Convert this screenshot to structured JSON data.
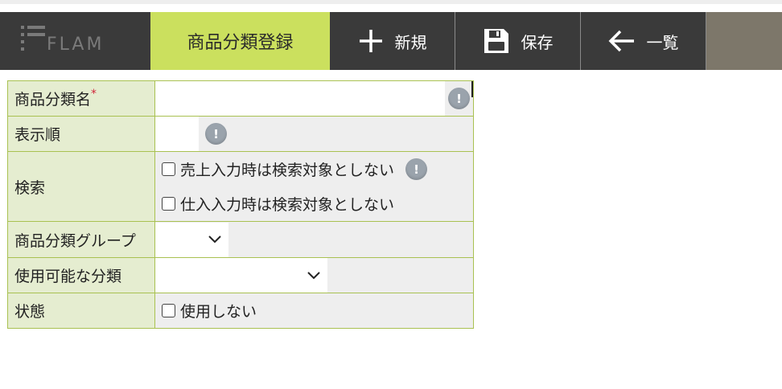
{
  "app": {
    "logo_text": "FLAM"
  },
  "nav": {
    "active_tab": "商品分類登録",
    "new_label": "新規",
    "save_label": "保存",
    "list_label": "一覧"
  },
  "form": {
    "name_label": "商品分類名",
    "required_mark": "*",
    "order_label": "表示順",
    "search_label": "検索",
    "search_option_sales": "売上入力時は検索対象としない",
    "search_option_purchase": "仕入入力時は検索対象としない",
    "group_label": "商品分類グループ",
    "usable_label": "使用可能な分類",
    "state_label": "状態",
    "state_option": "使用しない",
    "info_glyph": "!"
  },
  "colors": {
    "nav_bg": "#3a3a3a",
    "active_tab_bg": "#cbe05e",
    "label_bg": "#e5edd0",
    "border": "#a9c151",
    "required": "#d0263a"
  },
  "icons": [
    "flam-logo-icon",
    "plus-icon",
    "floppy-disk-icon",
    "arrow-left-icon",
    "info-icon",
    "chevron-down-icon"
  ]
}
